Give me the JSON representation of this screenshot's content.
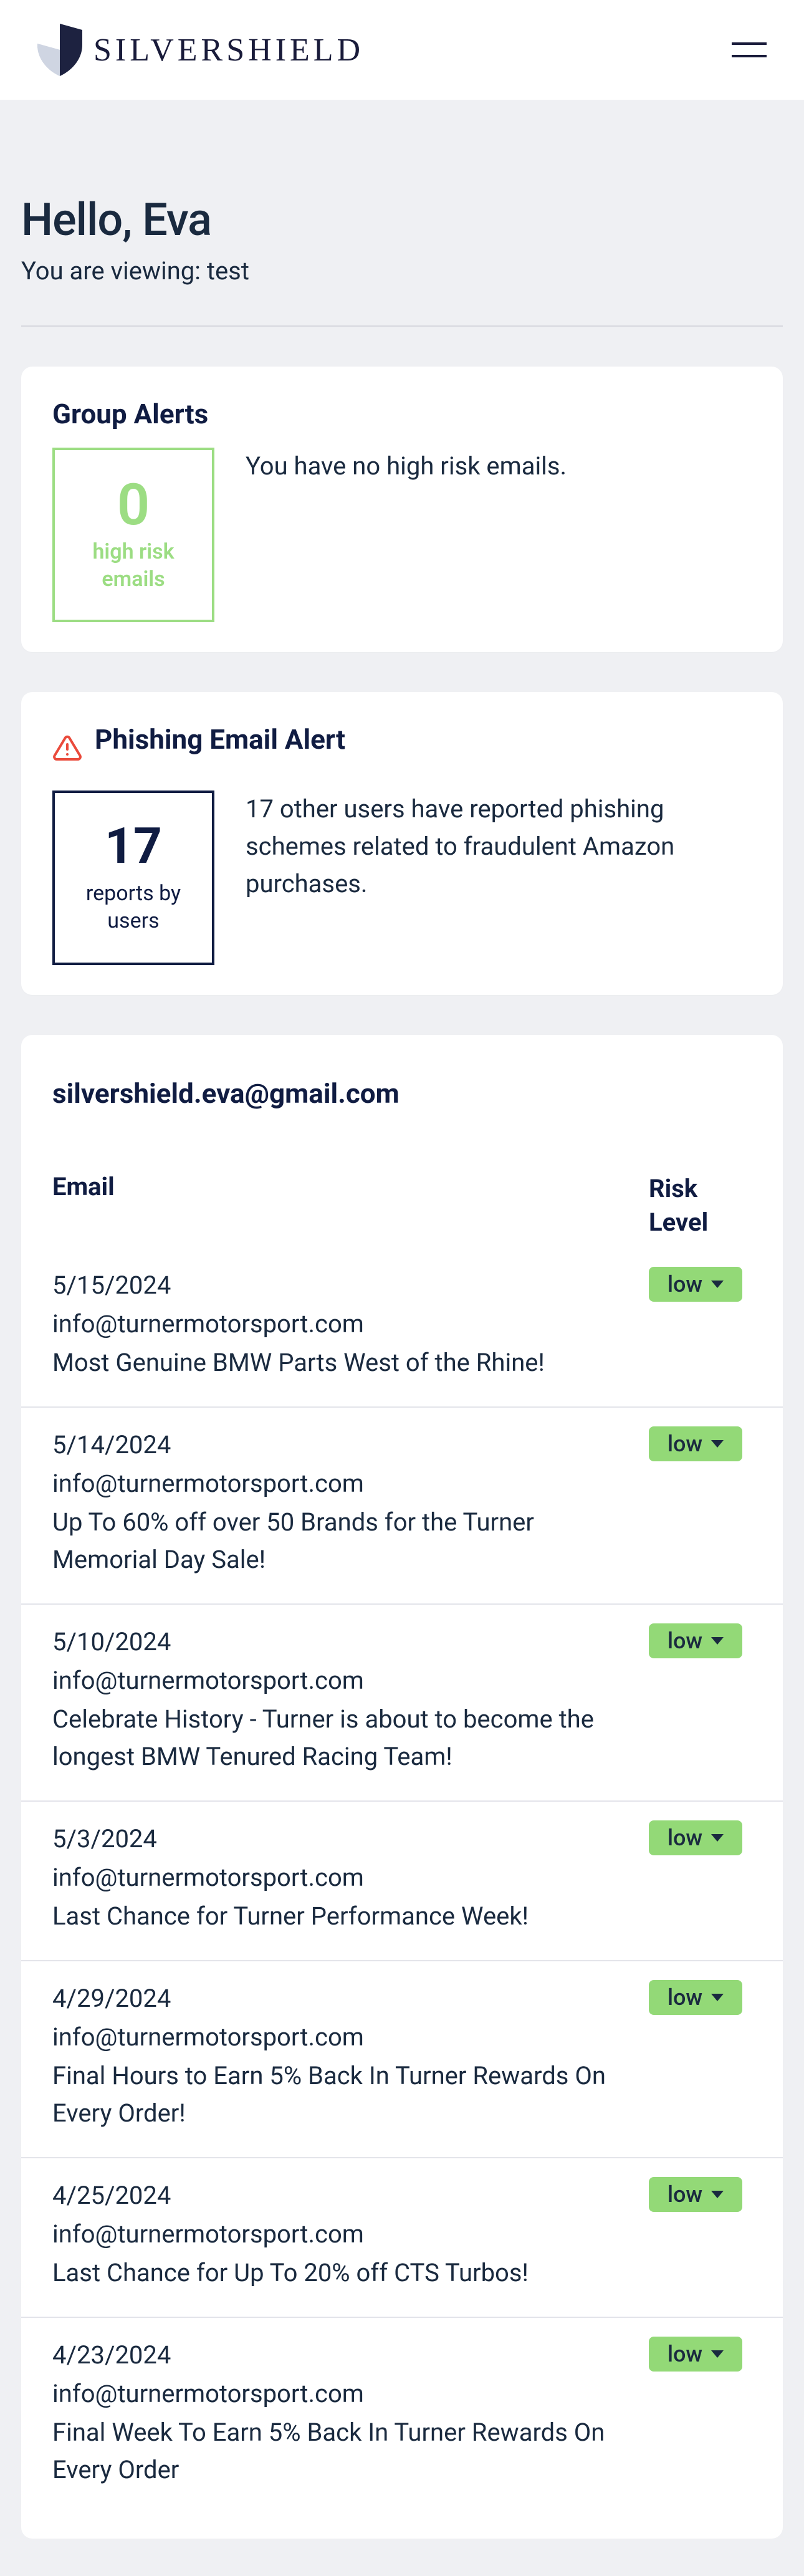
{
  "brand": "SILVERSHIELD",
  "greeting": "Hello, Eva",
  "viewing_prefix": "You are viewing: ",
  "viewing_value": "test",
  "group_alerts": {
    "title": "Group Alerts",
    "count": "0",
    "label_line1": "high risk",
    "label_line2": "emails",
    "message": "You have no high risk emails."
  },
  "phishing_alert": {
    "title": "Phishing Email Alert",
    "count": "17",
    "label_line1": "reports by",
    "label_line2": "users",
    "message": "17 other users have reported phishing schemes related to fraudulent Amazon purchases."
  },
  "account": "silvershield.eva@gmail.com",
  "table": {
    "header_email": "Email",
    "header_risk": "Risk Level"
  },
  "emails": [
    {
      "date": "5/15/2024",
      "from": "info@turnermotorsport.com",
      "subject": "Most Genuine BMW Parts West of the Rhine!",
      "risk": "low"
    },
    {
      "date": "5/14/2024",
      "from": "info@turnermotorsport.com",
      "subject": "Up To 60% off over 50 Brands for the Turner Memorial Day Sale!",
      "risk": "low"
    },
    {
      "date": "5/10/2024",
      "from": "info@turnermotorsport.com",
      "subject": "Celebrate History - Turner is about to become the longest BMW Tenured Racing Team!",
      "risk": "low"
    },
    {
      "date": "5/3/2024",
      "from": "info@turnermotorsport.com",
      "subject": "Last Chance for Turner Performance Week!",
      "risk": "low"
    },
    {
      "date": "4/29/2024",
      "from": "info@turnermotorsport.com",
      "subject": "Final Hours to Earn 5% Back In Turner Rewards On Every Order!",
      "risk": "low"
    },
    {
      "date": "4/25/2024",
      "from": "info@turnermotorsport.com",
      "subject": "Last Chance for Up To 20% off CTS Turbos!",
      "risk": "low"
    },
    {
      "date": "4/23/2024",
      "from": "info@turnermotorsport.com",
      "subject": "Final Week To Earn 5% Back In Turner Rewards On Every Order",
      "risk": "low"
    }
  ]
}
